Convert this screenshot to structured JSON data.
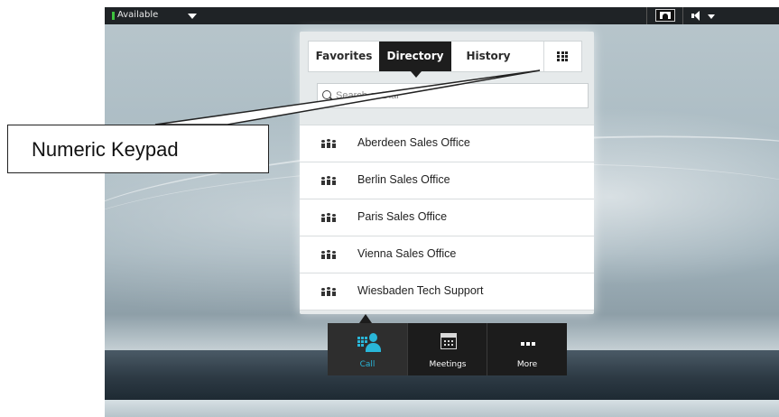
{
  "status_bar": {
    "availability": "Available",
    "icons": [
      "caret-down-icon",
      "self-view-icon",
      "volume-icon",
      "caret-down-icon"
    ],
    "available_color": "#3ec33e"
  },
  "directory_panel": {
    "tabs": [
      {
        "label": "Favorites",
        "active": false
      },
      {
        "label": "Directory",
        "active": true
      },
      {
        "label": "History",
        "active": false
      }
    ],
    "keypad_icon": "numeric-keypad-icon",
    "search": {
      "placeholder": "Search or Dial",
      "value": ""
    },
    "entries": [
      {
        "label": "Aberdeen Sales Office",
        "icon": "group-icon"
      },
      {
        "label": "Berlin Sales Office",
        "icon": "group-icon"
      },
      {
        "label": "Paris Sales Office",
        "icon": "group-icon"
      },
      {
        "label": "Vienna Sales Office",
        "icon": "group-icon"
      },
      {
        "label": "Wiesbaden Tech Support",
        "icon": "group-icon"
      }
    ]
  },
  "bottom_nav": {
    "items": [
      {
        "label": "Call",
        "icon": "call-icon",
        "active": true
      },
      {
        "label": "Meetings",
        "icon": "calendar-icon",
        "active": false
      },
      {
        "label": "More",
        "icon": "more-icon",
        "active": false
      }
    ],
    "accent_color": "#29b6d8"
  },
  "annotation": {
    "callout_label": "Numeric Keypad"
  }
}
